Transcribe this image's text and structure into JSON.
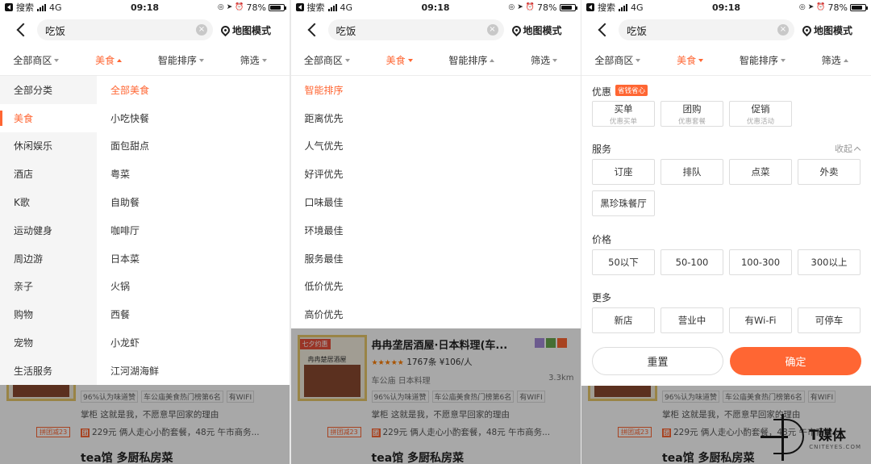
{
  "status_bar": {
    "carrier": "搜索",
    "network": "4G",
    "time": "09:18",
    "battery": "78%"
  },
  "header": {
    "search_value": "吃饭",
    "map_mode_label": "地图模式"
  },
  "filter_tabs": [
    {
      "label": "全部商区"
    },
    {
      "label": "美食"
    },
    {
      "label": "智能排序"
    },
    {
      "label": "筛选"
    }
  ],
  "panel1": {
    "left_categories": [
      "全部分类",
      "美食",
      "休闲娱乐",
      "酒店",
      "K歌",
      "运动健身",
      "周边游",
      "亲子",
      "购物",
      "宠物",
      "生活服务"
    ],
    "selected_left": "美食",
    "right_categories": [
      "全部美食",
      "小吃快餐",
      "面包甜点",
      "粤菜",
      "自助餐",
      "咖啡厅",
      "日本菜",
      "火锅",
      "西餐",
      "小龙虾",
      "江河湖海鲜"
    ],
    "selected_right": "全部美食"
  },
  "panel2": {
    "sort_options": [
      "智能排序",
      "距离优先",
      "人气优先",
      "好评优先",
      "口味最佳",
      "环境最佳",
      "服务最佳",
      "低价优先",
      "高价优先"
    ],
    "selected": "智能排序"
  },
  "panel3": {
    "promo": {
      "title": "优惠",
      "badge": "省钱省心",
      "chips": [
        {
          "label": "买单",
          "sub": "优惠买单"
        },
        {
          "label": "团购",
          "sub": "优惠套餐"
        },
        {
          "label": "促销",
          "sub": "优惠活动"
        }
      ]
    },
    "service": {
      "title": "服务",
      "collapse": "收起",
      "chips": [
        "订座",
        "排队",
        "点菜",
        "外卖",
        "黑珍珠餐厅"
      ]
    },
    "price": {
      "title": "价格",
      "chips": [
        "50以下",
        "50-100",
        "100-300",
        "300以上"
      ]
    },
    "more": {
      "title": "更多",
      "chips": [
        "新店",
        "营业中",
        "有Wi-Fi",
        "可停车"
      ]
    },
    "reset_label": "重置",
    "confirm_label": "确定"
  },
  "listing": {
    "image_tag": "七夕约惠",
    "image_sign": "冉冉楚居酒屋",
    "name": "冉冉垄居酒屋·日本料理(车...",
    "reviews": "1767条",
    "price": "¥106/人",
    "area": "车公庙",
    "category": "日本料理",
    "distance": "3.3km",
    "tags": [
      "96%认为味道赞",
      "车公庙美食热门榜第6名",
      "有WIFI"
    ],
    "owner_note": "掌柜 这就是我，不愿意早回家的理由",
    "group_badge": "拼团减23",
    "deal": "229元 俩人走心小酌套餐，48元 午市商务...",
    "next_name": "tea馆 多厨私房菜"
  },
  "watermark": {
    "big": "T媒体",
    "small": "CNITEYES.COM"
  },
  "colors": {
    "accent": "#ff6633",
    "dim": "rgba(0,0,0,0.34)"
  }
}
